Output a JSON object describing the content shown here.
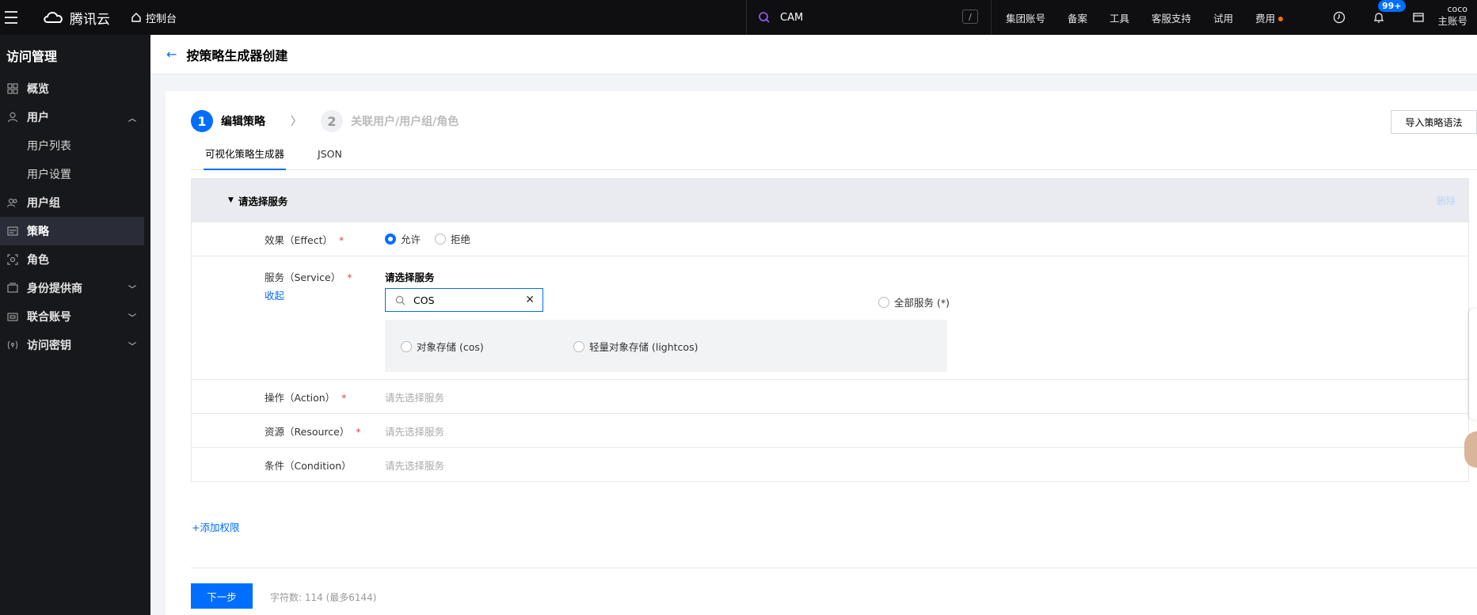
{
  "topbar": {
    "brand": "腾讯云",
    "console": "控制台",
    "search_text": "CAM",
    "search_shortcut": "/",
    "nav": [
      "集团账号",
      "备案",
      "工具",
      "客服支持",
      "试用",
      "费用"
    ],
    "notification_badge": "99+",
    "user_line1": "coco",
    "user_line2": "主账号"
  },
  "sidebar": {
    "title": "访问管理",
    "items": [
      {
        "label": "概览",
        "icon": "grid-icon"
      },
      {
        "label": "用户",
        "icon": "user-icon"
      },
      {
        "label": "用户列表"
      },
      {
        "label": "用户设置"
      },
      {
        "label": "用户组",
        "icon": "users-icon"
      },
      {
        "label": "策略",
        "icon": "policy-icon"
      },
      {
        "label": "角色",
        "icon": "role-icon"
      },
      {
        "label": "身份提供商",
        "icon": "idp-icon"
      },
      {
        "label": "联合账号",
        "icon": "federation-icon"
      },
      {
        "label": "访问密钥",
        "icon": "key-icon"
      }
    ]
  },
  "page": {
    "title": "按策略生成器创建"
  },
  "steps": [
    {
      "num": "1",
      "label": "编辑策略"
    },
    {
      "num": "2",
      "label": "关联用户/用户组/角色"
    }
  ],
  "import_button": "导入策略语法",
  "tabs": [
    "可视化策略生成器",
    "JSON"
  ],
  "panel": {
    "heading": "请选择服务",
    "delete": "删除",
    "effect_label": "效果（Effect）",
    "effect_allow": "允许",
    "effect_deny": "拒绝",
    "service_label": "服务（Service）",
    "collapse": "收起",
    "service_title": "请选择服务",
    "service_search_value": "COS",
    "service_all": "全部服务 (*)",
    "service_option_1": "对象存储 (cos)",
    "service_option_2": "轻量对象存储 (lightcos)",
    "action_label": "操作（Action）",
    "action_placeholder": "请先选择服务",
    "resource_label": "资源（Resource）",
    "resource_placeholder": "请先选择服务",
    "condition_label": "条件（Condition）",
    "condition_placeholder": "请先选择服务",
    "required_mark": "*"
  },
  "add_permission": "添加权限",
  "next_button": "下一步",
  "char_count": "字符数: 114 (最多6144)",
  "colors": {
    "accent": "#006eff",
    "topbar_bg": "#0f0f12",
    "sidebar_bg": "#17181c"
  }
}
